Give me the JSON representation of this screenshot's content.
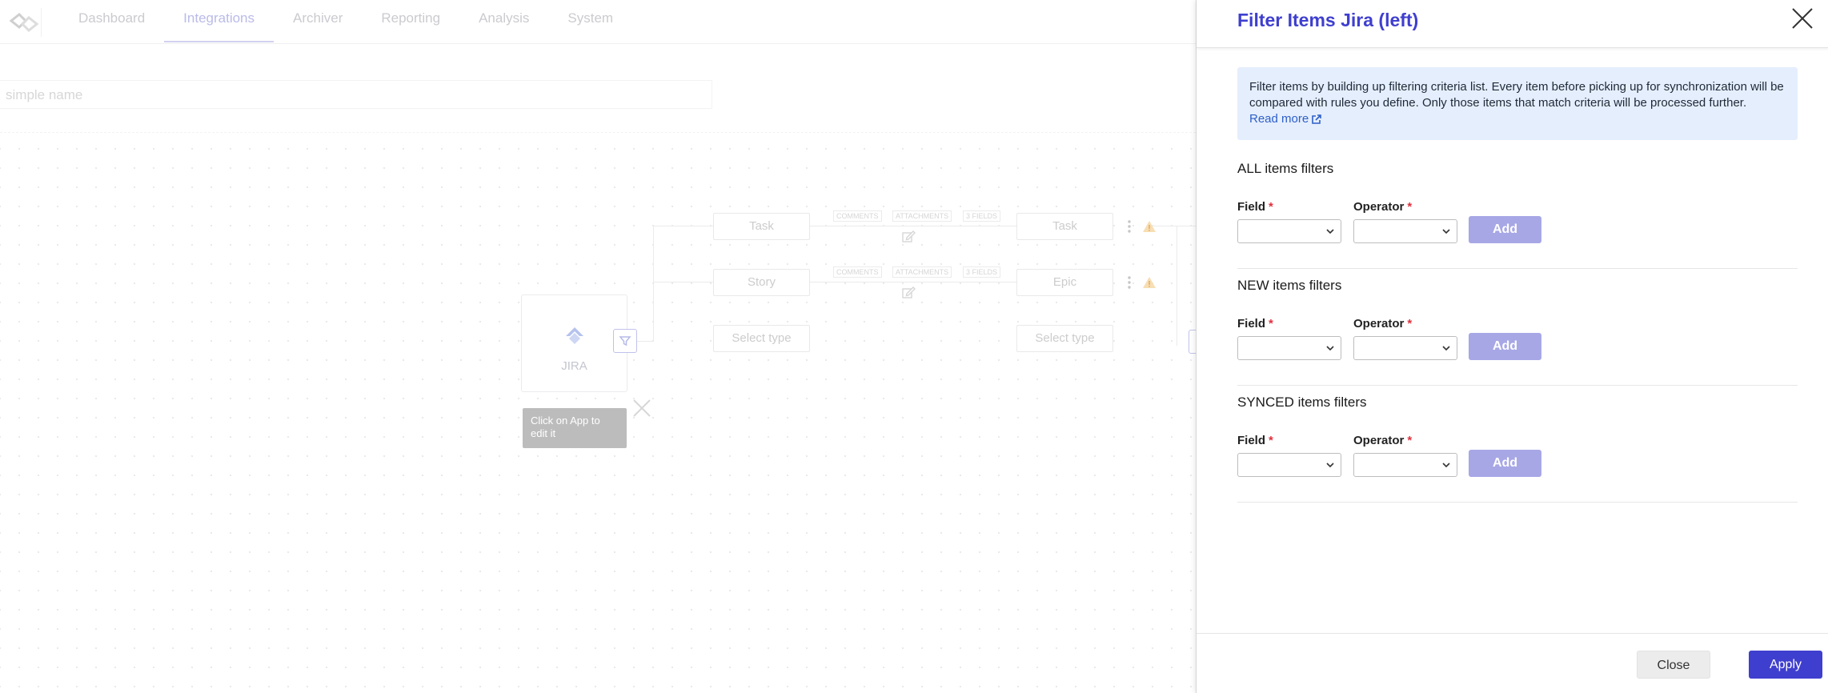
{
  "nav": {
    "items": [
      {
        "label": "Dashboard"
      },
      {
        "label": "Integrations"
      },
      {
        "label": "Archiver"
      },
      {
        "label": "Reporting"
      },
      {
        "label": "Analysis"
      },
      {
        "label": "System"
      }
    ],
    "active": "Integrations"
  },
  "integration": {
    "name_placeholder": "simple name",
    "app_label": "JIRA",
    "tooltip": "Click on App to edit it",
    "left_types": [
      "Task",
      "Story",
      "Select type"
    ],
    "right_types": [
      "Task",
      "Epic",
      "Select type"
    ],
    "tags": [
      "COMMENTS",
      "ATTACHMENTS",
      "3 FIELDS"
    ]
  },
  "panel": {
    "title": "Filter Items Jira (left)",
    "info_text": "Filter items by building up filtering criteria list. Every item before picking up for synchronization will be compared with rules you define. Only those items that match criteria will be processed further.",
    "read_more": "Read more",
    "sections": [
      {
        "title": "ALL items filters",
        "field_label": "Field",
        "operator_label": "Operator",
        "required": "*",
        "field_value": "",
        "operator_value": "",
        "add_label": "Add"
      },
      {
        "title": "NEW items filters",
        "field_label": "Field",
        "operator_label": "Operator",
        "required": "*",
        "field_value": "",
        "operator_value": "",
        "add_label": "Add"
      },
      {
        "title": "SYNCED items filters",
        "field_label": "Field",
        "operator_label": "Operator",
        "required": "*",
        "field_value": "",
        "operator_value": "",
        "add_label": "Add"
      }
    ],
    "close_label": "Close",
    "apply_label": "Apply"
  },
  "colors": {
    "accent": "#3f3fcf",
    "add_button": "#a7a7e6",
    "info_bg": "#e5eefc",
    "required": "#e0303e"
  },
  "icons": [
    "logo-icon",
    "filter-icon",
    "close-icon",
    "external-link-icon",
    "chevron-down-icon",
    "edit-icon",
    "kebab-menu-icon",
    "warning-icon",
    "jira-icon"
  ]
}
